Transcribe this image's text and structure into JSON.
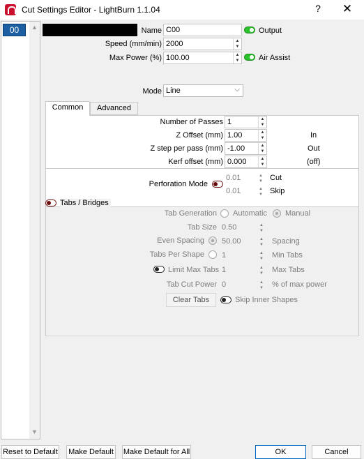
{
  "window": {
    "title": "Cut Settings Editor - LightBurn 1.1.04",
    "help": "?",
    "close": "✕"
  },
  "list": {
    "items": [
      "00"
    ]
  },
  "top": {
    "name_label": "Name",
    "name_value": "C00",
    "output_label": "Output",
    "speed_label": "Speed (mm/min)",
    "speed_value": "2000",
    "power_label": "Max Power (%)",
    "power_value": "100.00",
    "air_label": "Air Assist",
    "mode_label": "Mode",
    "mode_value": "Line",
    "layer_color": "#000000"
  },
  "tabs": {
    "common": "Common",
    "advanced": "Advanced"
  },
  "common": {
    "passes_label": "Number of Passes",
    "passes_value": "1",
    "zoffset_label": "Z Offset (mm)",
    "zoffset_value": "1.00",
    "zoffset_unit": "In",
    "zstep_label": "Z step per pass (mm)",
    "zstep_value": "-1.00",
    "zstep_unit": "Out",
    "kerf_label": "Kerf offset (mm)",
    "kerf_value": "0.000",
    "kerf_unit": "(off)",
    "perf_label": "Perforation Mode",
    "perf_cut_value": "0.01",
    "perf_cut_label": "Cut",
    "perf_skip_value": "0.01",
    "perf_skip_label": "Skip"
  },
  "tabsgroup": {
    "title": "Tabs / Bridges",
    "gen_label": "Tab Generation",
    "auto_label": "Automatic",
    "manual_label": "Manual",
    "size_label": "Tab Size",
    "size_value": "0.50",
    "even_label": "Even Spacing",
    "even_value": "50.00",
    "spacing_label": "Spacing",
    "per_shape_label": "Tabs Per Shape",
    "per_shape_value": "1",
    "min_tabs_label": "Min Tabs",
    "limit_label": "Limit Max Tabs",
    "limit_value": "1",
    "max_tabs_label": "Max Tabs",
    "power_label": "Tab Cut Power",
    "power_value": "0",
    "power_unit": "% of max power",
    "clear_label": "Clear Tabs",
    "skip_inner_label": "Skip Inner Shapes"
  },
  "footer": {
    "reset": "Reset to Default",
    "make_default": "Make Default",
    "make_default_all": "Make Default for All",
    "ok": "OK",
    "cancel": "Cancel"
  }
}
